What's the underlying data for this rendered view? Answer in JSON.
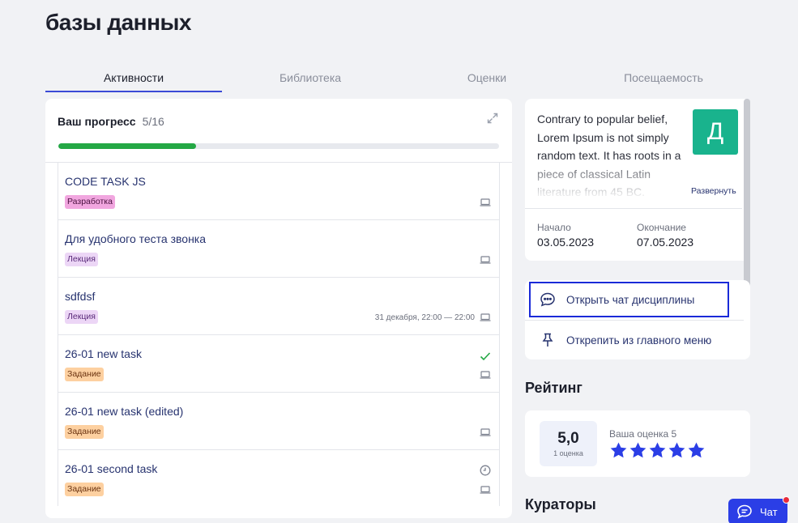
{
  "page": {
    "title": "базы данных"
  },
  "tabs": [
    {
      "label": "Активности",
      "active": true
    },
    {
      "label": "Библиотека",
      "active": false
    },
    {
      "label": "Оценки",
      "active": false
    },
    {
      "label": "Посещаемость",
      "active": false
    }
  ],
  "progress": {
    "label": "Ваш прогресс",
    "count": "5/16",
    "fraction": 0.3125,
    "color": "#24a845"
  },
  "activities": [
    {
      "title": "CODE TASK JS",
      "badge": "Разработка",
      "meta": "",
      "status": ""
    },
    {
      "title": "Для удобного теста звонка",
      "badge": "Лекция",
      "meta": "",
      "status": ""
    },
    {
      "title": "sdfdsf",
      "badge": "Лекция",
      "meta": "31 декабря, 22:00 — 22:00",
      "status": ""
    },
    {
      "title": "26-01 new task",
      "badge": "Задание",
      "meta": "",
      "status": "check-icon"
    },
    {
      "title": "26-01 new task (edited)",
      "badge": "Задание",
      "meta": "",
      "status": ""
    },
    {
      "title": "26-01 second task",
      "badge": "Задание",
      "meta": "",
      "status": "clock-icon"
    }
  ],
  "course": {
    "description": "Contrary to popular belief, Lorem Ipsum is not simply random text. It has roots in a piece of classical Latin literature from 45 BC.",
    "avatar_letter": "Д",
    "expand_label": "Развернуть",
    "start_label": "Начало",
    "start_date": "03.05.2023",
    "end_label": "Окончание",
    "end_date": "07.05.2023"
  },
  "actions": {
    "open_chat": "Открыть чат дисциплины",
    "unpin": "Открепить из главного меню"
  },
  "rating": {
    "title": "Рейтинг",
    "score": "5,0",
    "score_sub": "1 оценка",
    "your_rating": "Ваша оценка 5",
    "stars_filled": 5,
    "stars_total": 5
  },
  "curators": {
    "title": "Кураторы"
  },
  "chat": {
    "label": "Чат"
  },
  "colors": {
    "accent": "#2b3ee6",
    "avatar": "#19b38d",
    "progress": "#24a845"
  }
}
